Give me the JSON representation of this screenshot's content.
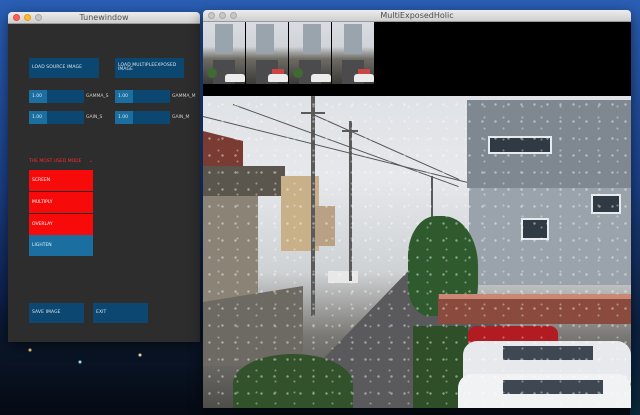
{
  "tunewindow": {
    "title": "Tunewindow",
    "load_source_label": "LOAD SOURCE IMAGE",
    "load_multiple_label": "LOAD MULTIPLEEXPOSED IMAGE",
    "sliders": [
      {
        "value": "1.00",
        "label": "GAMMA_S"
      },
      {
        "value": "1.00",
        "label": "GAMMA_M"
      },
      {
        "value": "1.00",
        "label": "GAIN_S"
      },
      {
        "value": "1.00",
        "label": "GAIN_M"
      }
    ],
    "blend_header": "THE MOST USED MODE",
    "blend_modes": [
      "SCREEN",
      "MULTIPLY",
      "OVERLAY",
      "LIGHTEN"
    ],
    "selected_mode": "LIGHTEN",
    "save_label": "SAVE IMAGE",
    "exit_label": "EXIT"
  },
  "multiwindow": {
    "title": "MultiExposedHolic",
    "thumbnail_count": 4
  },
  "colors": {
    "button": "#0b4770",
    "slider_fill": "#1a6ea0",
    "mode_item": "#f70a0a",
    "mode_header": "#ff2b2b",
    "panel_bg": "#2d2d2d"
  },
  "icons": [
    "close-icon",
    "minimize-icon",
    "zoom-icon",
    "chevron-down-icon"
  ]
}
